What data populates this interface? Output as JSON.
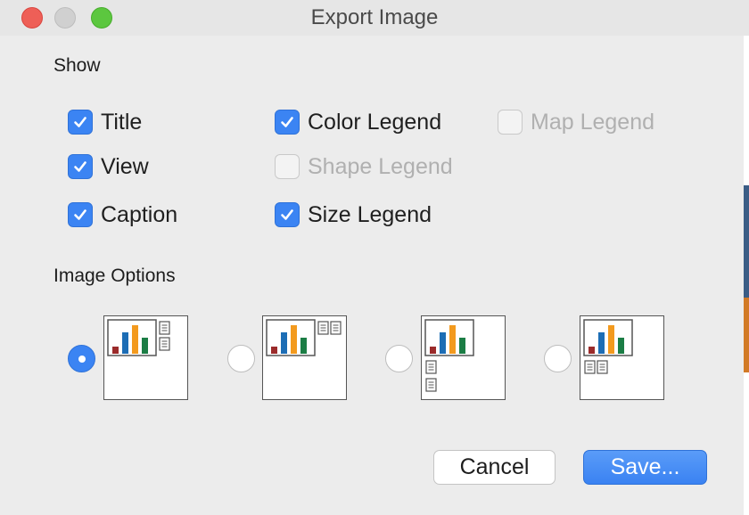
{
  "window": {
    "title": "Export Image",
    "controls": [
      "close",
      "minimize",
      "zoom"
    ]
  },
  "show": {
    "heading": "Show",
    "options": [
      {
        "label": "Title",
        "checked": true,
        "enabled": true
      },
      {
        "label": "View",
        "checked": true,
        "enabled": true
      },
      {
        "label": "Caption",
        "checked": true,
        "enabled": true
      },
      {
        "label": "Color Legend",
        "checked": true,
        "enabled": true
      },
      {
        "label": "Shape Legend",
        "checked": false,
        "enabled": false
      },
      {
        "label": "Size Legend",
        "checked": true,
        "enabled": true
      },
      {
        "label": "Map Legend",
        "checked": false,
        "enabled": false
      }
    ]
  },
  "image_options": {
    "heading": "Image Options",
    "layouts": [
      {
        "selected": true,
        "legend_placement": "right"
      },
      {
        "selected": false,
        "legend_placement": "top-right"
      },
      {
        "selected": false,
        "legend_placement": "bottom-left"
      },
      {
        "selected": false,
        "legend_placement": "bottom"
      }
    ]
  },
  "buttons": {
    "cancel": "Cancel",
    "save": "Save..."
  },
  "colors": {
    "accent": "#3b84f3",
    "close": "#ee5f57",
    "zoom": "#5cc73f",
    "bar_red": "#9b2b2b",
    "bar_blue": "#1c6db5",
    "bar_orange": "#f39a1e",
    "bar_green": "#1b7d45"
  }
}
